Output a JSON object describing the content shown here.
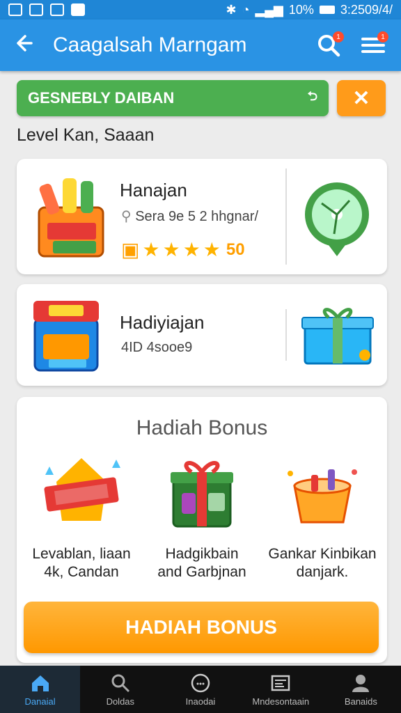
{
  "status": {
    "battery": "10%",
    "time": "3:2509/4/"
  },
  "appbar": {
    "title": "Caagalsah Marngam",
    "search_badge": "1",
    "menu_badge": "1"
  },
  "banner": {
    "text": "GESNEBLY DAIBAN",
    "arrow": "⮌",
    "close": "✕"
  },
  "section_label": "Level Kan, Saaan",
  "card1": {
    "title": "Hanajan",
    "subtitle": "Sera 9e 5 2 hhgnar/",
    "score": "50",
    "rating": 4
  },
  "card2": {
    "title": "Hadiyiajan",
    "subtitle": "4ID 4sooe9"
  },
  "bonus": {
    "title": "Hadiah Bonus",
    "items": [
      {
        "line1": "Levablan, liaan",
        "line2": "4k, Candan"
      },
      {
        "line1": "Hadgikbain",
        "line2": "and Garbjnan"
      },
      {
        "line1": "Gankar Kinbikan",
        "line2": "danjark."
      }
    ],
    "button": "HADIAH BONUS"
  },
  "nav": {
    "items": [
      {
        "label": "Danaial",
        "icon": "home-icon"
      },
      {
        "label": "Doldas",
        "icon": "search-icon"
      },
      {
        "label": "Inaodai",
        "icon": "chat-icon"
      },
      {
        "label": "Mndesontaain",
        "icon": "document-icon"
      },
      {
        "label": "Banaids",
        "icon": "profile-icon"
      }
    ]
  },
  "colors": {
    "appbar": "#2a93e4",
    "banner": "#4caf50",
    "accent": "#ff9800",
    "nav_active": "#4aa9f5"
  }
}
